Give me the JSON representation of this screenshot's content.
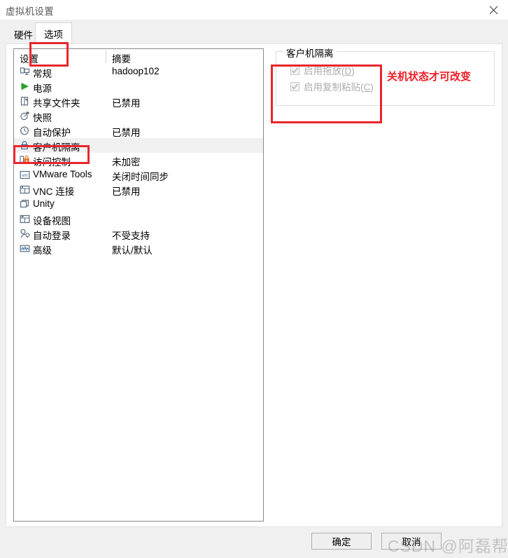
{
  "window": {
    "title": "虚拟机设置",
    "close_icon": "close-icon"
  },
  "tabs": [
    {
      "label": "硬件",
      "active": false
    },
    {
      "label": "选项",
      "active": true
    }
  ],
  "list": {
    "header": {
      "settings": "设置",
      "summary": "摘要"
    },
    "rows": [
      {
        "icon": "monitor-icon",
        "label": "常规",
        "summary": "hadoop102",
        "selected": false
      },
      {
        "icon": "power-play-icon",
        "label": "电源",
        "summary": "",
        "selected": false
      },
      {
        "icon": "folder-icon",
        "label": "共享文件夹",
        "summary": "已禁用",
        "selected": false
      },
      {
        "icon": "camera-icon",
        "label": "快照",
        "summary": "",
        "selected": false
      },
      {
        "icon": "clock-icon",
        "label": "自动保护",
        "summary": "已禁用",
        "selected": false
      },
      {
        "icon": "lock-icon",
        "label": "客户机隔离",
        "summary": "",
        "selected": true
      },
      {
        "icon": "access-lock-icon",
        "label": "访问控制",
        "summary": "未加密",
        "selected": false
      },
      {
        "icon": "vmware-tools-icon",
        "label": "VMware Tools",
        "summary": "关闭时间同步",
        "selected": false
      },
      {
        "icon": "vnc-icon",
        "label": "VNC 连接",
        "summary": "已禁用",
        "selected": false
      },
      {
        "icon": "unity-icon",
        "label": "Unity",
        "summary": "",
        "selected": false
      },
      {
        "icon": "device-view-icon",
        "label": "设备视图",
        "summary": "",
        "selected": false
      },
      {
        "icon": "autologin-icon",
        "label": "自动登录",
        "summary": "不受支持",
        "selected": false
      },
      {
        "icon": "advanced-icon",
        "label": "高级",
        "summary": "默认/默认",
        "selected": false
      }
    ]
  },
  "options_panel": {
    "group_title": "客户机隔离",
    "checkboxes": [
      {
        "label_before": "启用拖放(",
        "accel": "D",
        "label_after": ")",
        "checked": true,
        "disabled": true
      },
      {
        "label_before": "启用复制粘贴(",
        "accel": "C",
        "label_after": ")",
        "checked": true,
        "disabled": true
      }
    ],
    "note": "关机状态才可改变",
    "note_color": "#ee1c25"
  },
  "footer": {
    "ok_label": "确定",
    "cancel_label": "取消"
  },
  "watermark": {
    "text": "CSDN @阿磊帮助学"
  },
  "annotations": {
    "highlight_color": "#e8262d"
  }
}
